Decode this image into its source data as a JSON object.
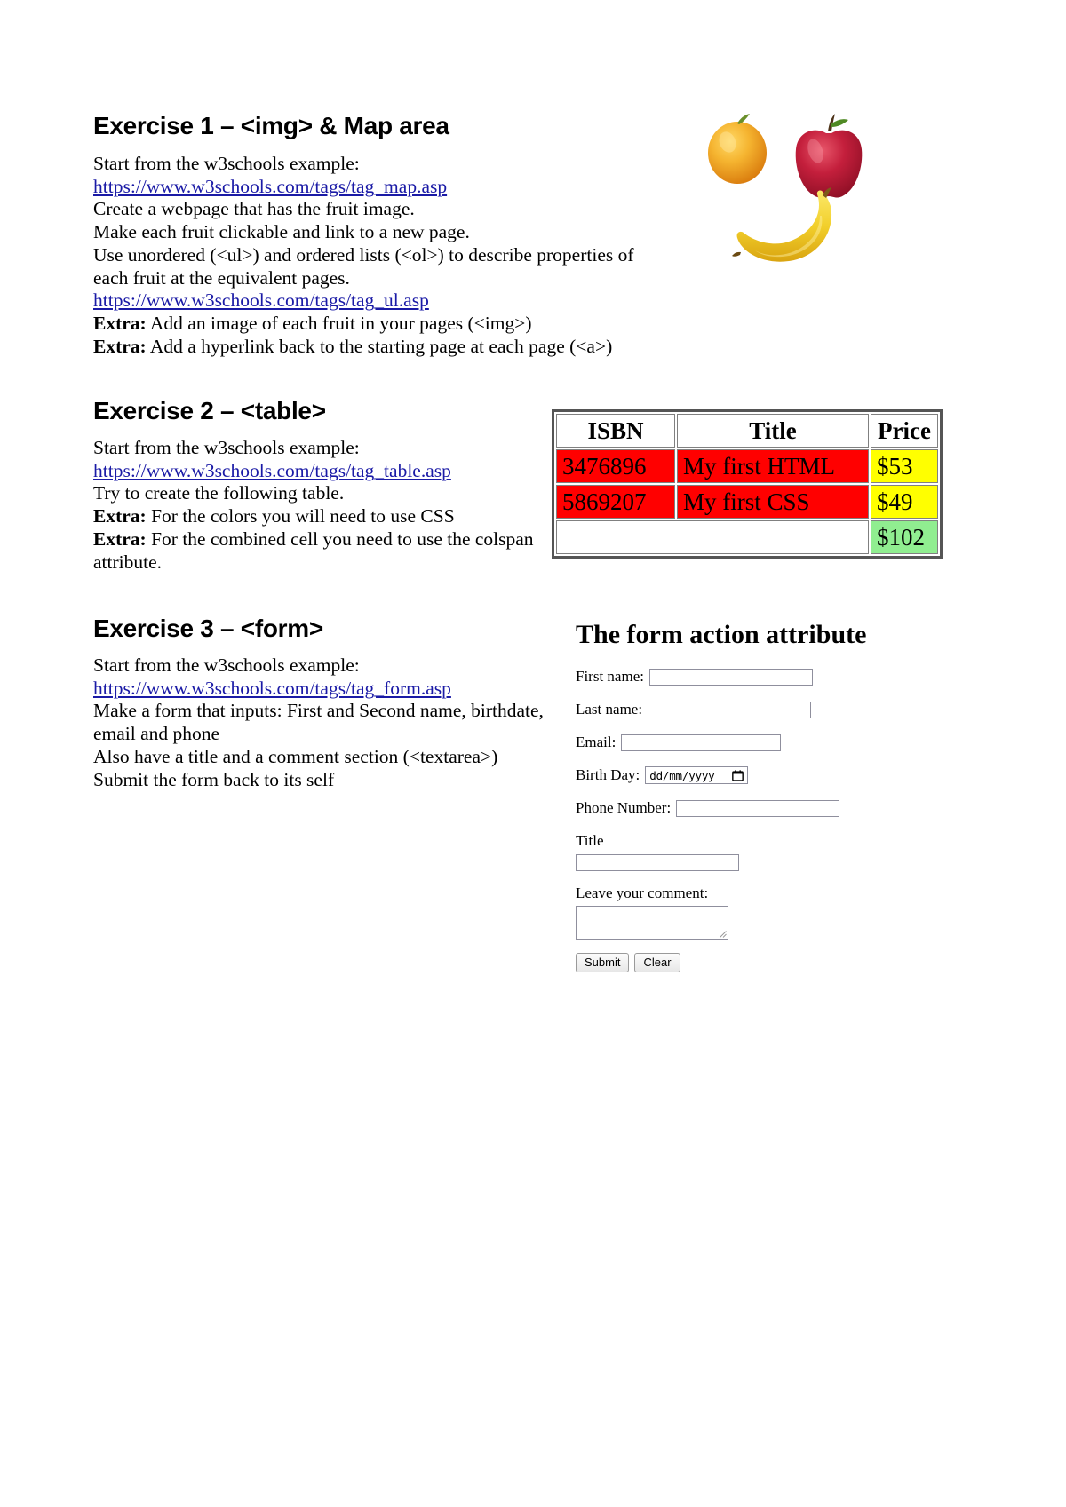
{
  "document": {
    "title": "HTML Exercises Worksheet"
  },
  "exercise1": {
    "heading": "Exercise 1 – <img> & Map area",
    "lines": [
      "Start from the w3schools example:",
      "Create a webpage that has the fruit image.",
      "Make each fruit clickable and link to a new page.",
      "Use unordered (<ul>) and ordered lists (<ol>) to describe properties of each fruit at the equivalent pages."
    ],
    "link_map": "https://www.w3schools.com/tags/tag_map.asp",
    "link_ul": "https://www.w3schools.com/tags/tag_ul.asp",
    "extra_label": "Extra:",
    "extra1": " Add an image of each fruit in your pages (<img>)",
    "extra2": " Add a hyperlink back to the starting page at each page (<a>)",
    "image_alt": "fruit-image-apricot-apple-banana"
  },
  "exercise2": {
    "heading": "Exercise 2 – <table>",
    "lines": [
      "Start from the w3schools example:",
      "Try to create the following table."
    ],
    "link_table": "https://www.w3schools.com/tags/tag_table.asp",
    "extra_label": "Extra:",
    "extra1": " For the colors you will need to use CSS",
    "extra2": " For the combined cell you need to use the colspan attribute.",
    "table": {
      "headers": [
        "ISBN",
        "Title",
        "Price"
      ],
      "rows": [
        {
          "isbn": "3476896",
          "title": "My first HTML",
          "price": "$53"
        },
        {
          "isbn": "5869207",
          "title": "My first CSS",
          "price": "$49"
        }
      ],
      "total_row": {
        "spanned_cell": "",
        "price": "$102"
      },
      "colors": {
        "header_bg": "#ffffff",
        "data_bg": "#ff0000",
        "price_bg": "#ffff00",
        "total_bg": "#90ee90",
        "border": "#555555"
      }
    }
  },
  "exercise3": {
    "heading": "Exercise 3 – <form>",
    "lines": [
      "Start from the w3schools example:",
      "Make a form that inputs: First and Second name, birthdate, email and phone",
      "Also have a title and a comment section (<textarea>)",
      "Submit the form back to its self"
    ],
    "link_form": "https://www.w3schools.com/tags/tag_form.asp",
    "form": {
      "title": "The form action attribute",
      "fields": [
        {
          "label": "First name:",
          "value": "",
          "type": "text"
        },
        {
          "label": "Last name:",
          "value": "",
          "type": "text"
        },
        {
          "label": "Email:",
          "value": "",
          "type": "text"
        },
        {
          "label": "Birth Day:",
          "value": "dd/mm/yyyy",
          "type": "date"
        },
        {
          "label": "Phone Number:",
          "value": "",
          "type": "text"
        }
      ],
      "title_field": {
        "label": "Title",
        "value": ""
      },
      "comment_field": {
        "label": "Leave your comment:",
        "value": ""
      },
      "submit_label": "Submit",
      "clear_label": "Clear"
    }
  }
}
